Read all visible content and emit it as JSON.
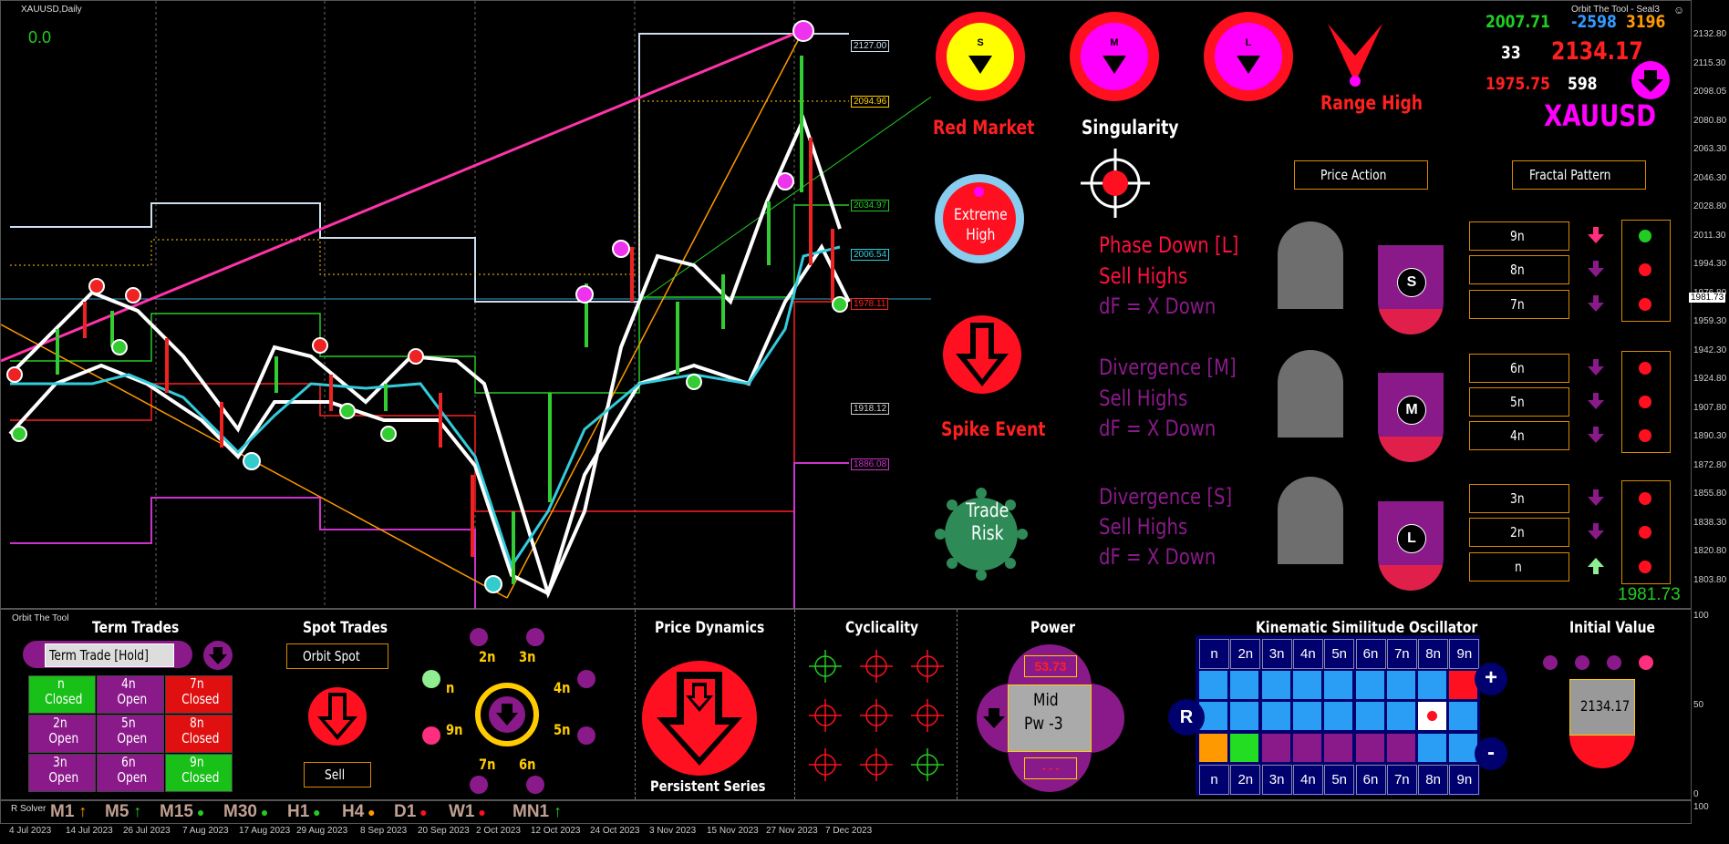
{
  "chart": {
    "symbol_label": "XAUUSD,Daily",
    "top_value": "0.0",
    "indicator_title": "Orbit The Tool - Seal3",
    "price_axis": [
      "2132.80",
      "2115.30",
      "2098.05",
      "2080.80",
      "2063.30",
      "2046.30",
      "2028.80",
      "2011.30",
      "1994.30",
      "1976.80",
      "1959.30",
      "1942.30",
      "1924.80",
      "1907.80",
      "1890.30",
      "1872.80",
      "1855.80",
      "1838.30",
      "1820.80",
      "1803.80"
    ],
    "current_price_tag": "1981.73",
    "level_labels": {
      "l2127": "2127.00",
      "l2094": "2094.96",
      "l2034": "2034.97",
      "l2006": "2006.54",
      "l1978": "1978.11",
      "l1918": "1918.12",
      "l1886": "1886.08"
    },
    "date_axis": [
      "4 Jul 2023",
      "14 Jul 2023",
      "26 Jul 2023",
      "7 Aug 2023",
      "17 Aug 2023",
      "29 Aug 2023",
      "8 Sep 2023",
      "20 Sep 2023",
      "2 Oct 2023",
      "12 Oct 2023",
      "24 Oct 2023",
      "3 Nov 2023",
      "15 Nov 2023",
      "27 Nov 2023",
      "7 Dec 2023"
    ],
    "sub_axis": [
      "100",
      "50",
      "0"
    ],
    "sub_axis_top": "100"
  },
  "header_stats": {
    "v1": "2007.71",
    "v2": "-2598",
    "v3": "3196",
    "v4": "33",
    "v5": "2134.17",
    "v6": "1975.75",
    "v7": "598",
    "symbol": "XAUUSD"
  },
  "circles": {
    "s": "S",
    "m": "M",
    "l": "L"
  },
  "labels": {
    "red_market": "Red Market",
    "singularity": "Singularity",
    "range_high": "Range High",
    "extreme_high": "Extreme\nHigh",
    "spike_event": "Spike Event",
    "trade_risk": "Trade\nRisk",
    "price_action": "Price Action",
    "fractal_pattern": "Fractal Pattern"
  },
  "phases": [
    {
      "title": "Phase Down [L]",
      "line2": "Sell Highs",
      "line3": "dF = X Down",
      "badge": "S"
    },
    {
      "title": "Divergence [M]",
      "line2": "Sell Highs",
      "line3": "dF = X Down",
      "badge": "M"
    },
    {
      "title": "Divergence [S]",
      "line2": "Sell Highs",
      "line3": "dF = X Down",
      "badge": "L"
    }
  ],
  "fractals": [
    "9n",
    "8n",
    "7n",
    "6n",
    "5n",
    "4n",
    "3n",
    "2n",
    "n"
  ],
  "last_price": "1981.73",
  "bottom": {
    "panel_name": "Orbit The Tool",
    "term_trades_title": "Term Trades",
    "term_trade_button": "Term Trade [Hold]",
    "term_cells": [
      {
        "a": "n",
        "b": "Closed",
        "c": "#18c018"
      },
      {
        "a": "4n",
        "b": "Open",
        "c": "#8a1a8a"
      },
      {
        "a": "7n",
        "b": "Closed",
        "c": "#e01010"
      },
      {
        "a": "2n",
        "b": "Open",
        "c": "#8a1a8a"
      },
      {
        "a": "5n",
        "b": "Open",
        "c": "#8a1a8a"
      },
      {
        "a": "8n",
        "b": "Closed",
        "c": "#e01010"
      },
      {
        "a": "3n",
        "b": "Open",
        "c": "#8a1a8a"
      },
      {
        "a": "6n",
        "b": "Open",
        "c": "#8a1a8a"
      },
      {
        "a": "9n",
        "b": "Closed",
        "c": "#18c018"
      }
    ],
    "spot_trades_title": "Spot Trades",
    "orbit_spot": "Orbit Spot",
    "sell": "Sell",
    "orbit_labels": [
      "2n",
      "3n",
      "4n",
      "5n",
      "6n",
      "7n",
      "9n",
      "n"
    ],
    "price_dynamics_title": "Price Dynamics",
    "persistent_series": "Persistent Series",
    "cyclicality_title": "Cyclicality",
    "power_title": "Power",
    "power_value": "53.73",
    "power_mid": "Mid",
    "power_pw": "Pw -3",
    "power_bottom": "- - -",
    "kso_title": "Kinematic Similitude Oscillator",
    "kso_cols": [
      "n",
      "2n",
      "3n",
      "4n",
      "5n",
      "6n",
      "7n",
      "8n",
      "9n"
    ],
    "kso_plus": "+",
    "kso_minus": "-",
    "kso_r": "R",
    "initial_value_title": "Initial Value",
    "initial_value": "2134.17",
    "r_solver": "R Solver",
    "timeframes": [
      "M1",
      "M5",
      "M15",
      "M30",
      "H1",
      "H4",
      "D1",
      "W1",
      "MN1"
    ]
  },
  "colors": {
    "magenta": "#ff00ff",
    "red": "#ff0000",
    "orange": "#d98a00",
    "navy": "#00006e",
    "purple": "#8a1a8a",
    "green": "#18c018"
  }
}
